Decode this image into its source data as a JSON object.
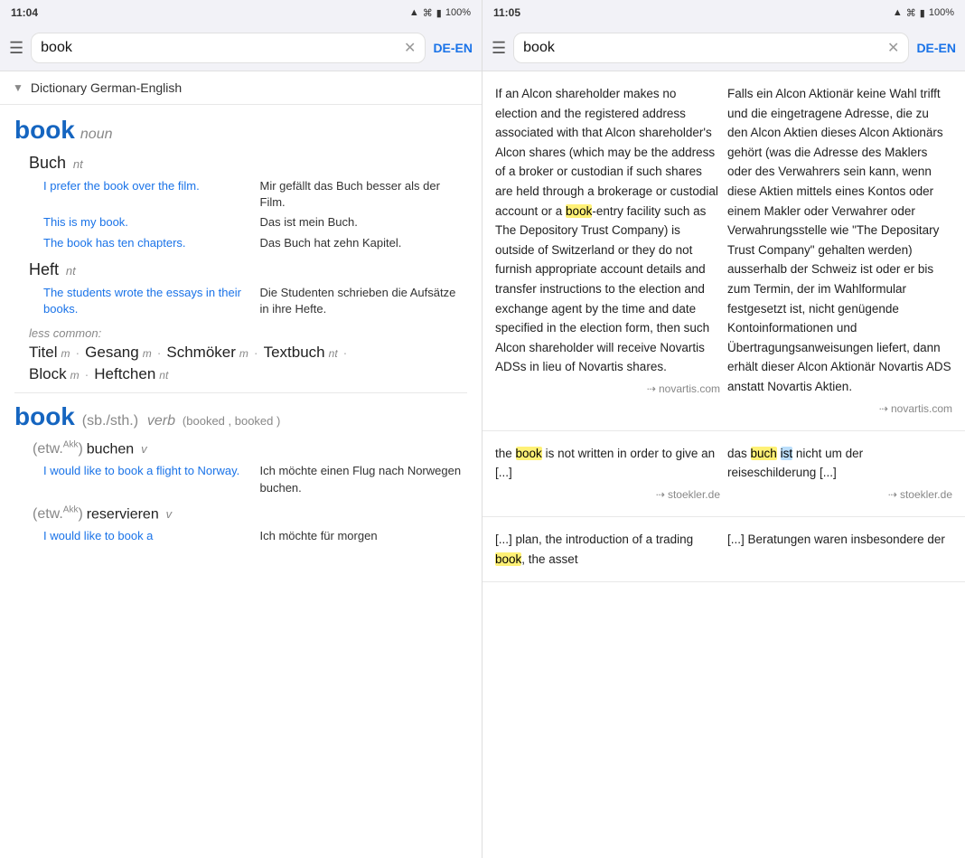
{
  "left_status": {
    "time": "11:04",
    "battery": "100%"
  },
  "right_status": {
    "time": "11:05",
    "battery": "100%"
  },
  "left_search": {
    "value": "book",
    "lang": "DE-EN"
  },
  "right_search": {
    "value": "book",
    "lang": "DE-EN"
  },
  "dict_header": {
    "title": "Dictionary German-English"
  },
  "noun_entry": {
    "headword": "book",
    "pos": "noun",
    "translations": [
      {
        "main": "Buch",
        "gender": "nt",
        "examples": [
          {
            "en": "I prefer the book over the film.",
            "de": "Mir gefällt das Buch besser als der Film."
          },
          {
            "en": "This is my book.",
            "de": "Das ist mein Buch."
          },
          {
            "en": "The book has ten chapters.",
            "de": "Das Buch hat zehn Kapitel."
          }
        ]
      },
      {
        "main": "Heft",
        "gender": "nt",
        "examples": [
          {
            "en": "The students wrote the essays in their books.",
            "de": "Die Studenten schrieben die Aufsätze in ihre Hefte."
          }
        ]
      }
    ],
    "less_common_label": "less common:",
    "less_common": [
      {
        "word": "Titel",
        "gender": "m"
      },
      {
        "word": "Gesang",
        "gender": "m"
      },
      {
        "word": "Schmöker",
        "gender": "m"
      },
      {
        "word": "Textbuch",
        "gender": "nt"
      },
      {
        "word": "Block",
        "gender": "m"
      },
      {
        "word": "Heftchen",
        "gender": "nt"
      }
    ]
  },
  "verb_entry": {
    "headword": "book",
    "obj": "(sb./sth.)",
    "pos": "verb",
    "forms": "(booked , booked )",
    "verb_translations": [
      {
        "obj_label": "(etw.",
        "obj_super": "Akk",
        "obj_close": ")",
        "word": "buchen",
        "pos": "v",
        "examples": [
          {
            "en": "I would like to book a flight to Norway.",
            "de": "Ich möchte einen Flug nach Norwegen buchen."
          }
        ]
      },
      {
        "obj_label": "(etw.",
        "obj_super": "Akk",
        "obj_close": ")",
        "word": "reservieren",
        "pos": "v",
        "examples": [
          {
            "en": "I would like to book a",
            "de": "Ich möchte für morgen"
          }
        ]
      }
    ]
  },
  "right_blocks": [
    {
      "left_text": "If an Alcon shareholder makes no election and the registered address associated with that Alcon shareholder's Alcon shares (which may be the address of a broker or custodian if such shares are held through a brokerage or custodial account or a book-entry facility such as The Depository Trust Company) is outside of Switzerland or they do not furnish appropriate account details and transfer instructions to the election and exchange agent by the time and date specified in the election form, then such Alcon shareholder will receive Novartis ADSs in lieu of Novartis shares.",
      "left_highlight_word": "book",
      "left_source": "novartis.com",
      "right_text": "Falls ein Alcon Aktionär keine Wahl trifft und die eingetragene Adresse, die zu den Alcon Aktien dieses Alcon Aktionärs gehört (was die Adresse des Maklers oder des Verwahrers sein kann, wenn diese Aktien mittels eines Kontos oder einem Makler oder Verwahrer oder Verwahrungsstelle wie \"The Depositary Trust Company\" gehalten werden) ausserhalb der Schweiz ist oder er bis zum Termin, der im Wahlformular festgesetzt ist, nicht genügende Kontoinformationen und Übertragungsanweisungen liefert, dann erhält dieser Alcon Aktionär Novartis ADS anstatt Novartis Aktien.",
      "right_source": "novartis.com"
    },
    {
      "left_text": "the book is not written in order to give an [...]",
      "left_source": "stoekler.de",
      "right_text": "das buch ist nicht um der reiseschilderung [...]",
      "right_source": "stoekler.de"
    },
    {
      "left_text": "[...] plan, the introduction of a trading book, the asset",
      "left_source": "",
      "right_text": "[...] Beratungen waren insbesondere der",
      "right_source": ""
    }
  ]
}
